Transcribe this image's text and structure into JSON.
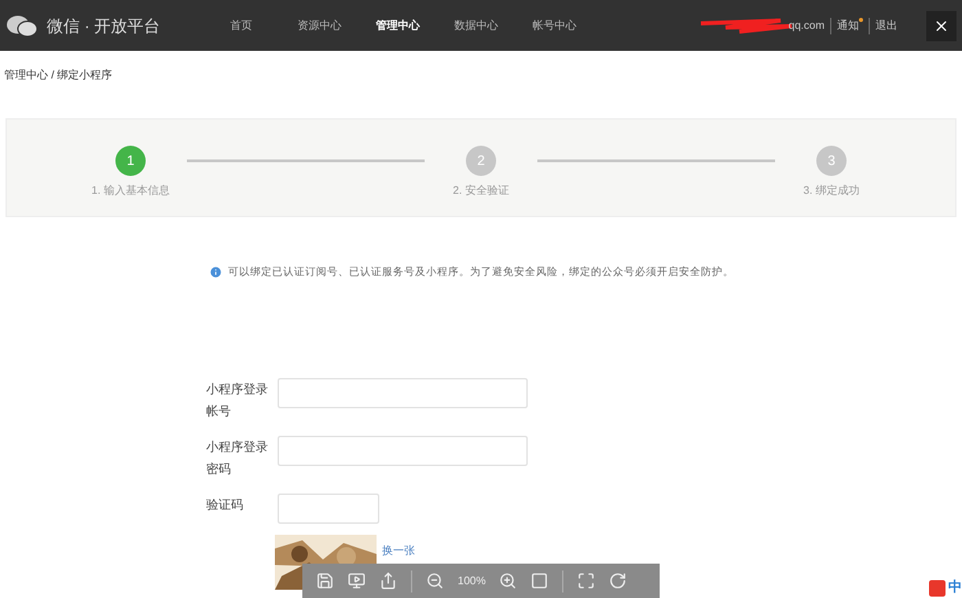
{
  "header": {
    "logo_text": "微信 · 开放平台",
    "nav": [
      {
        "label": "首页",
        "selected": false
      },
      {
        "label": "资源中心",
        "selected": false
      },
      {
        "label": "管理中心",
        "selected": true
      },
      {
        "label": "数据中心",
        "selected": false
      },
      {
        "label": "帐号中心",
        "selected": false
      }
    ],
    "account": "qq.com",
    "links": [
      {
        "label": "通知",
        "badge": true
      },
      {
        "label": "退出",
        "badge": false
      }
    ]
  },
  "breadcrumb": "管理中心 / 绑定小程序",
  "steps": [
    {
      "number": "1",
      "label": "1. 输入基本信息",
      "selected": true
    },
    {
      "number": "2",
      "label": "2. 安全验证",
      "selected": false
    },
    {
      "number": "3",
      "label": "3. 绑定成功",
      "selected": false
    }
  ],
  "notice": "可以绑定已认证订阅号、已认证服务号及小程序。为了避免安全风险，绑定的公众号必须开启安全防护。",
  "form": [
    {
      "label": "小程序登录帐号",
      "kind": "wide"
    },
    {
      "label": "小程序登录密码",
      "kind": "wide"
    },
    {
      "label": "验证码",
      "kind": "short"
    }
  ],
  "captcha": {
    "kind": "picture",
    "refresh": "换一张"
  },
  "viewer_toolbar": {
    "zoom": "100%"
  },
  "ime": {
    "mode": "中"
  }
}
